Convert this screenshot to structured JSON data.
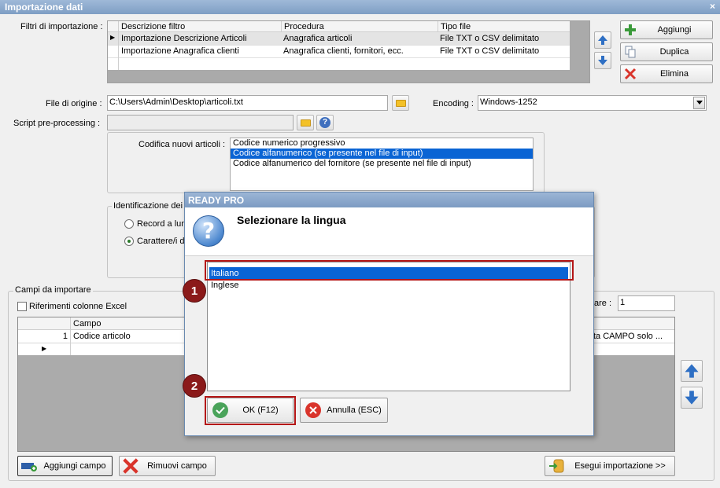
{
  "window": {
    "title": "Importazione dati",
    "close_glyph": "×"
  },
  "filters": {
    "label": "Filtri di importazione :",
    "columns": [
      "Descrizione filtro",
      "Procedura",
      "Tipo file"
    ],
    "rows": [
      {
        "descrizione": "Importazione Descrizione Articoli",
        "procedura": "Anagrafica articoli",
        "tipo": "File TXT o CSV delimitato"
      },
      {
        "descrizione": "Importazione Anagrafica clienti",
        "procedura": "Anagrafica clienti, fornitori, ecc.",
        "tipo": "File TXT o CSV delimitato"
      }
    ],
    "current_row_glyph": "▶"
  },
  "side_buttons": {
    "aggiungi": "Aggiungi",
    "duplica": "Duplica",
    "elimina": "Elimina"
  },
  "file_origine": {
    "label": "File di origine :",
    "value": "C:\\Users\\Admin\\Desktop\\articoli.txt"
  },
  "encoding": {
    "label": "Encoding :",
    "value": "Windows-1252"
  },
  "script": {
    "label": "Script pre-processing :",
    "value": ""
  },
  "codifica": {
    "label": "Codifica nuovi articoli :",
    "options": [
      "Codice numerico progressivo",
      "Codice alfanumerico (se presente nel file di input)",
      "Codice alfanumerico del fornitore (se presente nel file di input)"
    ],
    "selected_index": 1
  },
  "identificazione": {
    "legend": "Identificazione dei",
    "record_label": "Record a lun",
    "carattere_label": "Carattere/i d"
  },
  "campi": {
    "legend": "Campi da importare",
    "riferimenti_label": "Riferimenti colonne Excel",
    "right_label": "are :",
    "right_value": "1",
    "column_campo": "Campo",
    "rows": [
      {
        "num": "1",
        "campo": "Codice articolo",
        "note": "ta CAMPO solo ..."
      }
    ],
    "new_row_glyph": "▶"
  },
  "bottom_buttons": {
    "aggiungi_campo": "Aggiungi campo",
    "rimuovi_campo": "Rimuovi campo",
    "esegui": "Esegui importazione >>"
  },
  "dialog": {
    "title": "READY PRO",
    "heading": "Selezionare la lingua",
    "icon_glyph": "?",
    "languages": [
      "Italiano",
      "Inglese"
    ],
    "selected_index": 0,
    "ok_label": "OK (F12)",
    "cancel_label": "Annulla (ESC)"
  },
  "markers": [
    "1",
    "2"
  ],
  "colors": {
    "accent_blue": "#0a64d4",
    "marker_red": "#8b1a1a",
    "highlight_border": "#b41616",
    "ok_green": "#4aa35a",
    "cancel_red": "#d9342b",
    "arrow_blue": "#2e6fc4"
  }
}
